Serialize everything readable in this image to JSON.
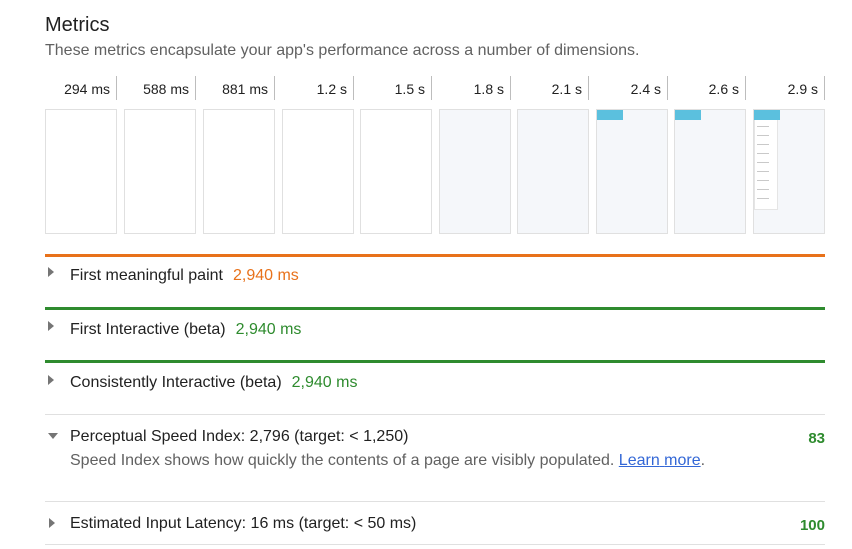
{
  "header": {
    "title": "Metrics",
    "subtitle": "These metrics encapsulate your app's performance across a number of dimensions."
  },
  "timeline": {
    "ticks": [
      "294 ms",
      "588 ms",
      "881 ms",
      "1.2 s",
      "1.5 s",
      "1.8 s",
      "2.1 s",
      "2.4 s",
      "2.6 s",
      "2.9 s"
    ]
  },
  "metrics": [
    {
      "label": "First meaningful paint",
      "value": "2,940 ms",
      "color": "#e8711a"
    },
    {
      "label": "First Interactive (beta)",
      "value": "2,940 ms",
      "color": "#2e8b2e"
    },
    {
      "label": "Consistently Interactive (beta)",
      "value": "2,940 ms",
      "color": "#2e8b2e"
    }
  ],
  "audits": [
    {
      "label": "Perceptual Speed Index: 2,796 (target: < 1,250)",
      "score": "83",
      "description": "Speed Index shows how quickly the contents of a page are visibly populated.",
      "link_text_1": "Learn",
      "link_text_2": "more",
      "after_link": "."
    },
    {
      "label": "Estimated Input Latency: 16 ms (target: < 50 ms)",
      "score": "100"
    }
  ]
}
